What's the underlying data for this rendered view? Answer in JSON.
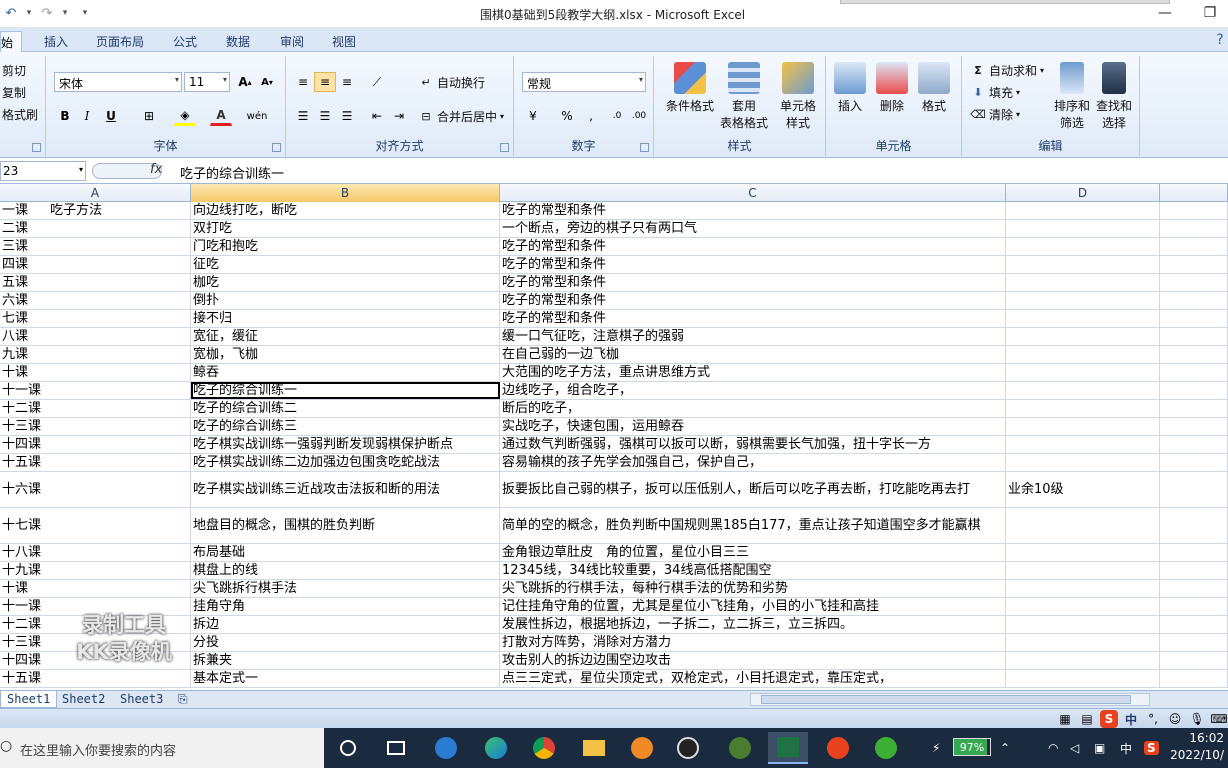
{
  "window": {
    "title": "围棋0基础到5段教学大纲.xlsx - Microsoft Excel"
  },
  "ribbon": {
    "tabs": [
      "始",
      "插入",
      "页面布局",
      "公式",
      "数据",
      "审阅",
      "视图"
    ],
    "clipboard": {
      "cut": "剪切",
      "copy": "复制",
      "format_painter": "格式刷"
    },
    "font": {
      "name": "宋体",
      "size": "11",
      "label": "字体"
    },
    "alignment": {
      "wrap": "自动换行",
      "merge": "合并后居中",
      "label": "对齐方式"
    },
    "number": {
      "format": "常规",
      "percent": "%",
      "comma": ",",
      "label": "数字"
    },
    "styles": {
      "conditional": "条件格式",
      "table_line1": "套用",
      "table_line2": "表格格式",
      "cell_line1": "单元格",
      "cell_line2": "样式",
      "label": "样式"
    },
    "cells": {
      "insert": "插入",
      "delete": "删除",
      "format": "格式",
      "label": "单元格"
    },
    "editing": {
      "autosum": "自动求和",
      "fill": "填充",
      "clear": "清除",
      "sort_line1": "排序和",
      "sort_line2": "筛选",
      "find_line1": "查找和",
      "find_line2": "选择",
      "label": "编辑"
    }
  },
  "formula_bar": {
    "name_box": "23",
    "fx": "fx",
    "content": "吃子的综合训练一"
  },
  "columns": [
    "A",
    "B",
    "C",
    "D"
  ],
  "rows": [
    {
      "a": "一课",
      "a2": "吃子方法",
      "b": "向边线打吃，断吃",
      "c": "吃子的常型和条件"
    },
    {
      "a": "二课",
      "b": "双打吃",
      "c": "一个断点，旁边的棋子只有两口气"
    },
    {
      "a": "三课",
      "b": "门吃和抱吃",
      "c": "吃子的常型和条件"
    },
    {
      "a": "四课",
      "b": "征吃",
      "c": "吃子的常型和条件"
    },
    {
      "a": "五课",
      "b": "枷吃",
      "c": "吃子的常型和条件"
    },
    {
      "a": "六课",
      "b": "倒扑",
      "c": "吃子的常型和条件"
    },
    {
      "a": "七课",
      "b": "接不归",
      "c": "吃子的常型和条件"
    },
    {
      "a": "八课",
      "b": "宽征，缓征",
      "c": "缓一口气征吃，注意棋子的强弱"
    },
    {
      "a": "九课",
      "b": "宽枷，飞枷",
      "c": "在自己弱的一边飞枷"
    },
    {
      "a": "十课",
      "b": "鲸吞",
      "c": "大范围的吃子方法，重点讲思维方式"
    },
    {
      "a": "十一课",
      "b": "吃子的综合训练一",
      "c": "边线吃子，组合吃子，",
      "active": true
    },
    {
      "a": "十二课",
      "b": "吃子的综合训练二",
      "c": "断后的吃子，"
    },
    {
      "a": "十三课",
      "b": "吃子的综合训练三",
      "c": "实战吃子，快速包围，运用鲸吞"
    },
    {
      "a": "十四课",
      "b": "吃子棋实战训练一强弱判断发现弱棋保护断点",
      "c": "通过数气判断强弱，强棋可以扳可以断，弱棋需要长气加强，扭十字长一方"
    },
    {
      "a": "十五课",
      "b": "吃子棋实战训练二边加强边包围贪吃蛇战法",
      "c": "容易输棋的孩子先学会加强自己，保护自己，"
    },
    {
      "a": "十六课",
      "b": "吃子棋实战训练三近战攻击法扳和断的用法",
      "c": "扳要扳比自己弱的棋子，扳可以压低别人，断后可以吃子再去断，打吃能吃再去打",
      "d": "业余10级",
      "tall": true
    },
    {
      "a": "十七课",
      "b": "地盘目的概念，围棋的胜负判断",
      "c": "简单的空的概念，胜负判断中国规则黑185白177，重点让孩子知道围空多才能赢棋",
      "tall": true
    },
    {
      "a": "十八课",
      "b": "布局基础",
      "c": "金角银边草肚皮　角的位置，星位小目三三"
    },
    {
      "a": "十九课",
      "b": "棋盘上的线",
      "c": "12345线，34线比较重要，34线高低搭配围空"
    },
    {
      "a": "十课",
      "b": "尖飞跳拆行棋手法",
      "c": "尖飞跳拆的行棋手法，每种行棋手法的优势和劣势"
    },
    {
      "a": "十一课",
      "b": "挂角守角",
      "c": "记住挂角守角的位置，尤其是星位小飞挂角，小目的小飞挂和高挂"
    },
    {
      "a": "十二课",
      "b": "拆边",
      "c": "发展性拆边，根据地拆边，一子拆二，立二拆三，立三拆四。"
    },
    {
      "a": "十三课",
      "b": "分投",
      "c": "打散对方阵势，消除对方潜力"
    },
    {
      "a": "十四课",
      "b": "拆兼夹",
      "c": "攻击别人的拆边边围空边攻击"
    },
    {
      "a": "十五课",
      "b": "基本定式一",
      "c": "点三三定式，星位尖顶定式，双枪定式，小目托退定式，靠压定式，"
    }
  ],
  "sheets": [
    "Sheet1",
    "Sheet2",
    "Sheet3"
  ],
  "watermark": {
    "line1": "录制工具",
    "line2": "KK录像机"
  },
  "taskbar": {
    "search_placeholder": "在这里输入你要搜索的内容",
    "battery": "97%",
    "ime": "中",
    "time": "16:02",
    "date": "2022/10/"
  },
  "status": {
    "ime_cn": "中"
  }
}
